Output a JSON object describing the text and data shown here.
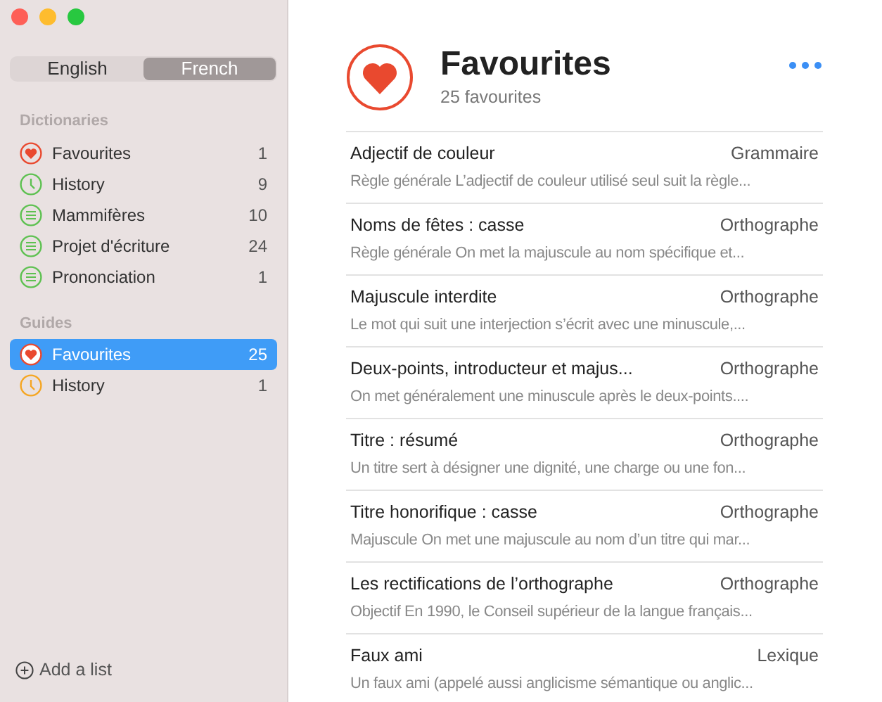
{
  "language_switch": [
    {
      "label": "English",
      "selected": false
    },
    {
      "label": "French",
      "selected": true
    }
  ],
  "sidebar": {
    "sections": [
      {
        "title": "Dictionaries",
        "items": [
          {
            "kind": "heart",
            "color": "#e9492f",
            "label": "Favourites",
            "count": "1",
            "selected": false
          },
          {
            "kind": "clock",
            "color": "#5ec151",
            "label": "History",
            "count": "9",
            "selected": false
          },
          {
            "kind": "list",
            "color": "#5ec151",
            "label": "Mammifères",
            "count": "10",
            "selected": false
          },
          {
            "kind": "list",
            "color": "#5ec151",
            "label": "Projet d'écriture",
            "count": "24",
            "selected": false
          },
          {
            "kind": "list",
            "color": "#5ec151",
            "label": "Prononciation",
            "count": "1",
            "selected": false
          }
        ]
      },
      {
        "title": "Guides",
        "items": [
          {
            "kind": "heart",
            "color": "#e9492f",
            "label": "Favourites",
            "count": "25",
            "selected": true
          },
          {
            "kind": "clock",
            "color": "#f5a623",
            "label": "History",
            "count": "1",
            "selected": false
          }
        ]
      }
    ],
    "add_list": "Add a list"
  },
  "header": {
    "title": "Favourites",
    "subtitle": "25 favourites"
  },
  "entries": [
    {
      "title": "Adjectif de couleur",
      "category": "Grammaire",
      "summary": "Règle générale L’adjectif de couleur utilisé seul suit la règle..."
    },
    {
      "title": "Noms de fêtes : casse",
      "category": "Orthographe",
      "summary": "Règle générale On met la majuscule au nom spécifique et..."
    },
    {
      "title": "Majuscule interdite",
      "category": "Orthographe",
      "summary": "Le mot qui suit une interjection s’écrit avec une minuscule,..."
    },
    {
      "title": "Deux-points, introducteur et majus...",
      "category": "Orthographe",
      "summary": "On met généralement une minuscule après le deux-points...."
    },
    {
      "title": "Titre : résumé",
      "category": "Orthographe",
      "summary": "Un titre sert à désigner une dignité, une charge ou une fon..."
    },
    {
      "title": "Titre honorifique : casse",
      "category": "Orthographe",
      "summary": "Majuscule On met une majuscule au nom d’un titre qui mar..."
    },
    {
      "title": "Les rectifications de l’orthographe",
      "category": "Orthographe",
      "summary": "Objectif En 1990, le Conseil supérieur de la langue français..."
    },
    {
      "title": "Faux ami",
      "category": "Lexique",
      "summary": "Un faux ami (appelé aussi anglicisme sémantique ou anglic..."
    }
  ]
}
